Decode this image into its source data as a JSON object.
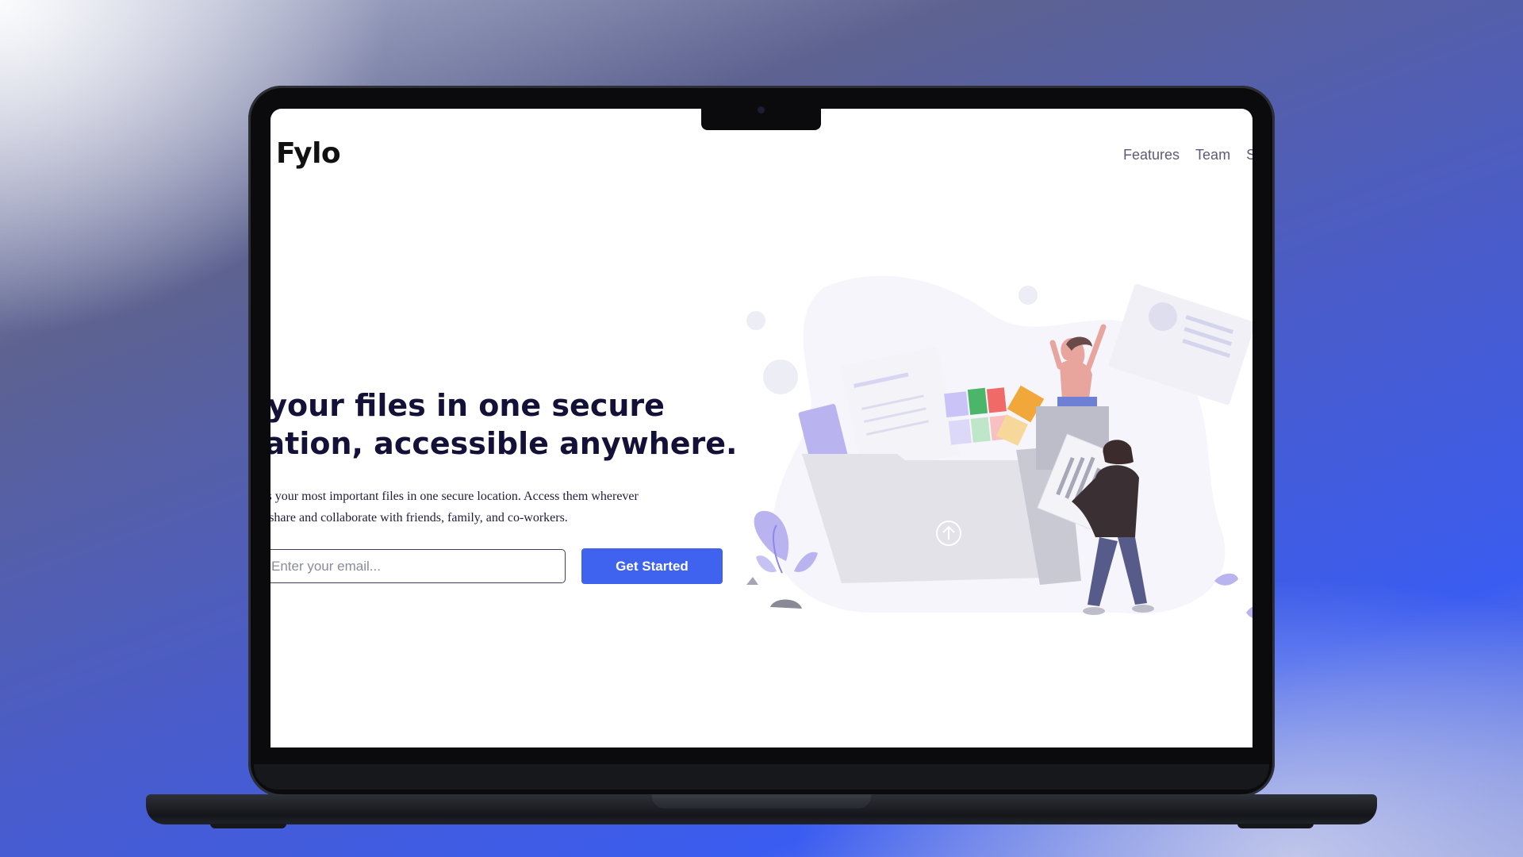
{
  "site": {
    "logo": "Fylo",
    "nav": [
      {
        "label": "Features"
      },
      {
        "label": "Team"
      },
      {
        "label": "S"
      }
    ]
  },
  "hero": {
    "title_lines": [
      "l your files in one secure",
      "cation, accessible anywhere."
    ],
    "text_lines": [
      "ylo stores your most important files in one secure location. Access them wherever",
      "ou need, share and collaborate with friends, family, and co-workers."
    ],
    "email_placeholder": "Enter your email...",
    "cta_label": "Get Started"
  },
  "colors": {
    "accent": "#3f63ee",
    "heading": "#141138",
    "nav_text": "#5c5b78"
  },
  "illustration": {
    "subject": "people-organizing-files-illustration",
    "icons": [
      "folder-icon",
      "upload-arrow-icon",
      "document-icon",
      "plant-icon"
    ]
  }
}
